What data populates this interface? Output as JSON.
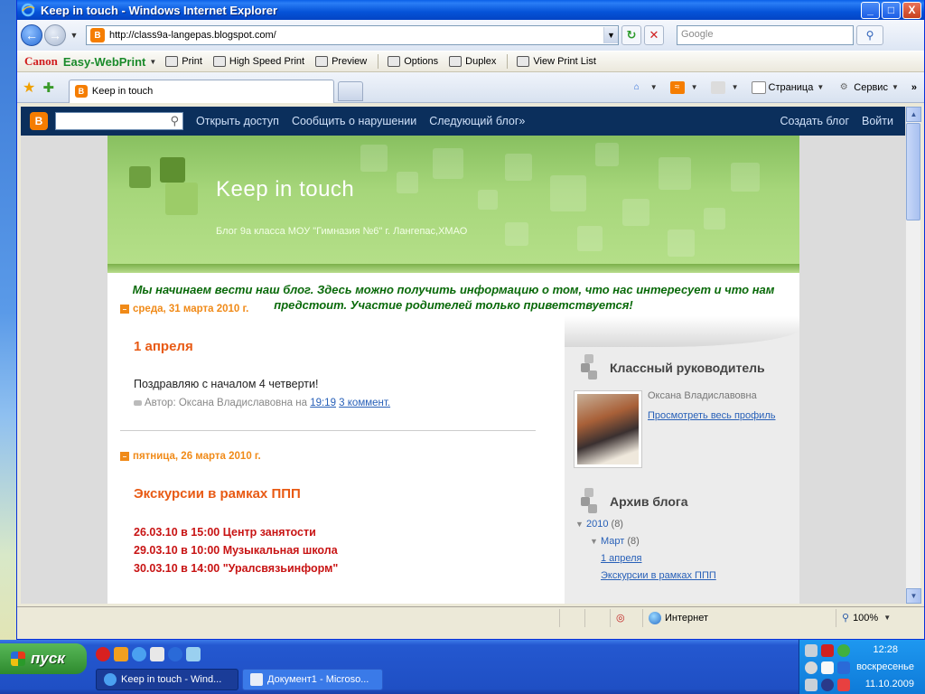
{
  "window": {
    "title": "Keep in touch - Windows Internet Explorer",
    "min": "_",
    "max": "□",
    "close": "X"
  },
  "address": {
    "url": "http://class9a-langepas.blogspot.com/",
    "search_placeholder": "Google"
  },
  "canon_toolbar": {
    "brand": "Canon",
    "product": "Easy-WebPrint",
    "items": [
      "Print",
      "High Speed Print",
      "Preview",
      "Options",
      "Duplex",
      "View Print List"
    ]
  },
  "tabs": {
    "active": "Keep in touch",
    "commands": [
      "Страница",
      "Сервис"
    ]
  },
  "blogger_nav": {
    "links": [
      "Открыть доступ",
      "Сообщить о нарушении",
      "Следующий блог»"
    ],
    "right": [
      "Создать блог",
      "Войти"
    ]
  },
  "blog": {
    "title": "Keep in touch",
    "description": "Блог 9а класса МОУ \"Гимназия №6\" г. Лангепас,ХМАО",
    "announcement": "Мы начинаем вести наш блог. Здесь можно получить информацию о том, что нас интересует и что нам предстоит. Участие родителей только приветствуется!"
  },
  "posts": [
    {
      "date": "среда, 31 марта 2010 г.",
      "title": "1 апреля",
      "body": "Поздравляю с началом 4 четверти!",
      "author_prefix": "Автор: Оксана Владиславовна на",
      "time": "19:19",
      "comments": "3 коммент."
    },
    {
      "date": "пятница, 26 марта 2010 г.",
      "title": "Экскурсии в рамках ППП",
      "lines": [
        "26.03.10 в 15:00 Центр занятости",
        "29.03.10 в 10:00 Музыкальная школа",
        "30.03.10 в 14:00 \"Уралсвязьинформ\""
      ]
    }
  ],
  "sidebar": {
    "teacher_heading": "Классный руководитель",
    "teacher_name": "Оксана Владиславовна",
    "profile_link": "Просмотреть весь профиль",
    "archive_heading": "Архив блога",
    "archive": {
      "year": "2010",
      "year_count": "(8)",
      "month": "Март",
      "month_count": "(8)",
      "items": [
        "1 апреля",
        "Экскурсии в рамках ППП"
      ]
    }
  },
  "status": {
    "zone": "Интернет",
    "zoom": "100%"
  },
  "taskbar": {
    "start": "пуск",
    "tasks": [
      "Keep in touch - Wind...",
      "Документ1 - Microso..."
    ],
    "clock": "12:28",
    "day": "воскресенье",
    "date": "11.10.2009"
  },
  "colors": {
    "title_bar": "#0553d8",
    "blogger_nav": "#0b2f5c",
    "header_green": "#a6d67a",
    "post_title": "#e85a14",
    "date_orange": "#f08a18",
    "announce_green": "#0a6a0a",
    "excursion_red": "#c81414"
  }
}
